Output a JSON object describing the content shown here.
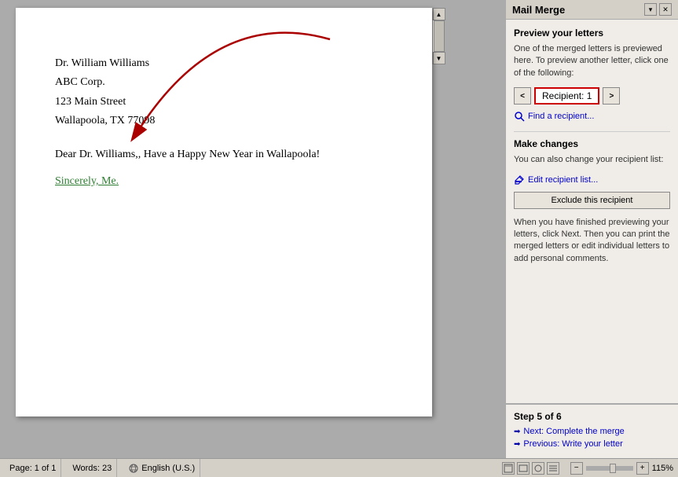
{
  "panel": {
    "title": "Mail Merge",
    "preview_section": {
      "heading": "Preview your letters",
      "description": "One of the merged letters is previewed here. To preview another letter, click one of the following:",
      "recipient_label": "Recipient: 1",
      "prev_btn": "<",
      "next_btn": ">",
      "find_link": "Find a recipient..."
    },
    "changes_section": {
      "heading": "Make changes",
      "description": "You can also change your recipient list:",
      "edit_link": "Edit recipient list...",
      "exclude_btn": "Exclude this recipient",
      "finish_desc": "When you have finished previewing your letters, click Next. Then you can print the merged letters or edit individual letters to add personal comments."
    },
    "footer": {
      "step_label": "Step 5 of 6",
      "next_link": "Next: Complete the merge",
      "prev_link": "Previous: Write your letter"
    }
  },
  "document": {
    "line1": "Dr. William Williams",
    "line2": "ABC Corp.",
    "line3": "123 Main Street",
    "line4": "Wallapoola, TX 77098",
    "body": "Dear Dr. Williams,, Have a Happy New Year in Wallapoola!",
    "signature": "Sincerely, Me."
  },
  "statusbar": {
    "page": "Page: 1 of 1",
    "words": "Words: 23",
    "language": "English (U.S.)",
    "zoom": "115%"
  }
}
